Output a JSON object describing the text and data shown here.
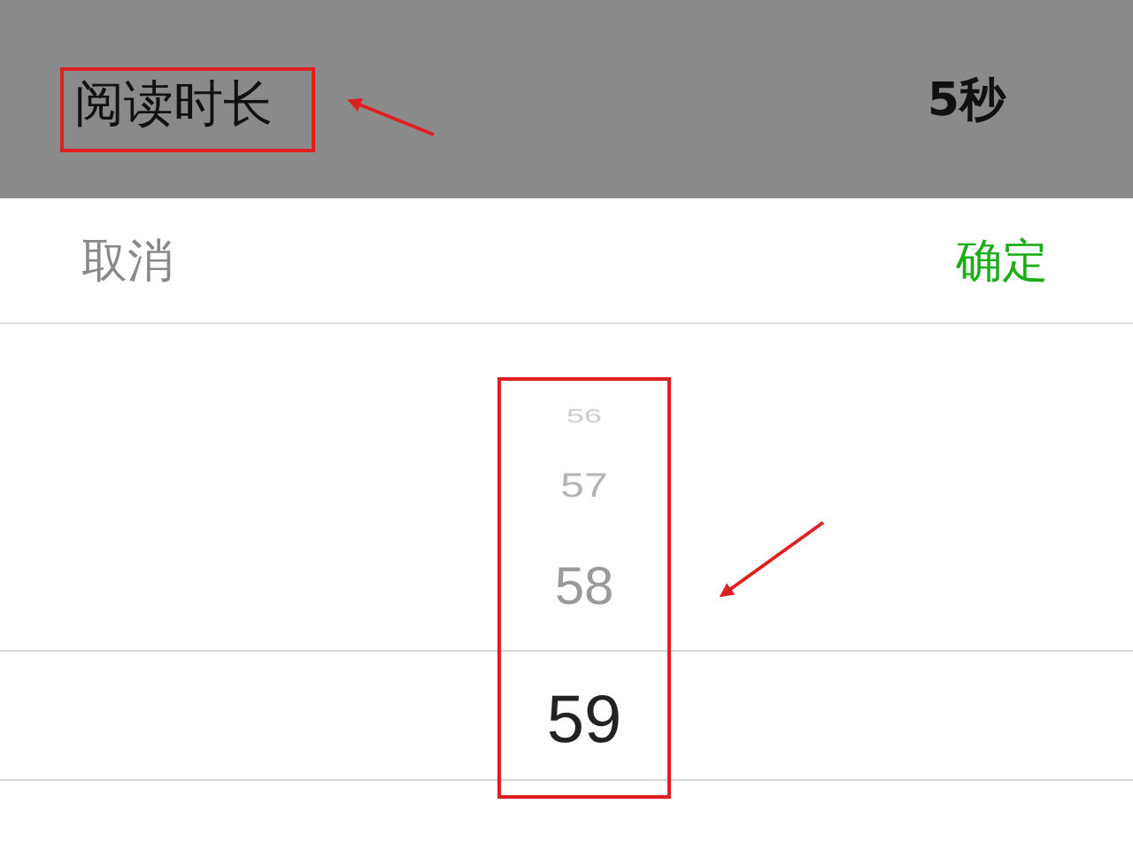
{
  "header": {
    "title": "阅读时长",
    "value": "5秒"
  },
  "actions": {
    "cancel": "取消",
    "confirm": "确定"
  },
  "picker": {
    "items": [
      {
        "label": "56",
        "selected": false
      },
      {
        "label": "57",
        "selected": false
      },
      {
        "label": "58",
        "selected": false
      },
      {
        "label": "59",
        "selected": true
      }
    ]
  }
}
